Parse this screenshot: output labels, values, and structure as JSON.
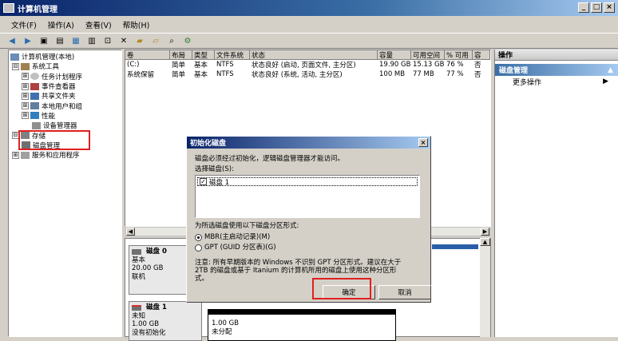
{
  "window": {
    "title": "计算机管理",
    "btn_min": "_",
    "btn_max": "□",
    "btn_close": "×"
  },
  "menu": [
    "文件(F)",
    "操作(A)",
    "查看(V)",
    "帮助(H)"
  ],
  "toolbar_icons": [
    "back-icon",
    "forward-icon",
    "up-icon",
    "show-hide-tree-icon",
    "properties-icon",
    "help-icon",
    "export-icon",
    "delete-icon",
    "folder-icon",
    "open-icon",
    "search-icon",
    "settings-icon"
  ],
  "tree": {
    "root": "计算机管理(本地)",
    "items": [
      {
        "label": "系统工具",
        "indent": 0,
        "exp": "⊟"
      },
      {
        "label": "任务计划程序",
        "indent": 1,
        "exp": "⊞"
      },
      {
        "label": "事件查看器",
        "indent": 1,
        "exp": "⊞"
      },
      {
        "label": "共享文件夹",
        "indent": 1,
        "exp": "⊞"
      },
      {
        "label": "本地用户和组",
        "indent": 1,
        "exp": "⊞"
      },
      {
        "label": "性能",
        "indent": 1,
        "exp": "⊞"
      },
      {
        "label": "设备管理器",
        "indent": 1,
        "exp": ""
      },
      {
        "label": "存储",
        "indent": 0,
        "exp": "⊟"
      },
      {
        "label": "磁盘管理",
        "indent": 1,
        "exp": ""
      },
      {
        "label": "服务和应用程序",
        "indent": 0,
        "exp": "⊞"
      }
    ]
  },
  "volumes": {
    "columns": [
      "卷",
      "布局",
      "类型",
      "文件系统",
      "状态",
      "容量",
      "可用空间",
      "% 可用",
      "容"
    ],
    "rows": [
      [
        "(C:)",
        "简单",
        "基本",
        "NTFS",
        "状态良好 (启动, 页面文件, 主分区)",
        "19.90 GB",
        "15.13 GB",
        "76 %",
        "否"
      ],
      [
        "系统保留",
        "简单",
        "基本",
        "NTFS",
        "状态良好 (系统, 活动, 主分区)",
        "100 MB",
        "77 MB",
        "77 %",
        "否"
      ]
    ]
  },
  "actions": {
    "header": "操作",
    "section": "磁盘管理",
    "more": "更多操作"
  },
  "disks": [
    {
      "name": "磁盘 0",
      "lines": [
        "基本",
        "20.00 GB",
        "联机"
      ]
    },
    {
      "name": "磁盘 1",
      "lines": [
        "未知",
        "1.00 GB",
        "没有初始化"
      ],
      "vol_lines": [
        "1.00 GB",
        "未分配"
      ]
    }
  ],
  "dialog": {
    "title": "初始化磁盘",
    "close": "×",
    "intro": "磁盘必须经过初始化，逻辑磁盘管理器才能访问。",
    "select_label": "选择磁盘(S):",
    "disk_item": "磁盘 1",
    "style_label": "为所选磁盘使用以下磁盘分区形式:",
    "option_mbr": "MBR(主启动记录)(M)",
    "option_gpt": "GPT (GUID 分区表)(G)",
    "note_line1": "注意: 所有早期版本的 Windows 不识别 GPT 分区形式。建议在大于",
    "note_line2": "2TB 的磁盘或基于 Itanium 的计算机所用的磁盘上使用这种分区形",
    "note_line3": "式。",
    "ok": "确定",
    "cancel": "取消"
  },
  "colors": {
    "highlight": "#e02020",
    "titlebar": "#0a246a",
    "window_bg": "#d4d0c8"
  }
}
